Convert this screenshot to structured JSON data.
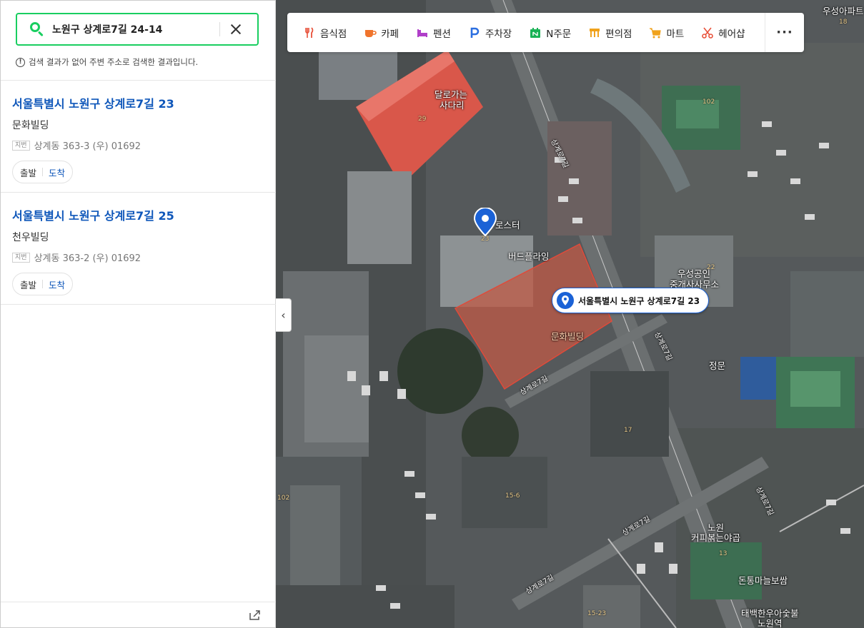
{
  "search": {
    "value": "노원구 상계로7길 24-14"
  },
  "notice": "검색 결과가 없어 주변 주소로 검색한 결과입니다.",
  "results": [
    {
      "title": "서울특별시 노원구 상계로7길 23",
      "name": "문화빌딩",
      "jibun_tag": "지번",
      "jibun": "상계동 363-3 (우) 01692",
      "start": "출발",
      "arrive": "도착"
    },
    {
      "title": "서울특별시 노원구 상계로7길 25",
      "name": "천우빌딩",
      "jibun_tag": "지번",
      "jibun": "상계동 363-2 (우) 01692",
      "start": "출발",
      "arrive": "도착"
    }
  ],
  "categories": [
    {
      "label": "음식점",
      "icon": "restaurant-icon",
      "color": "#e8513a"
    },
    {
      "label": "카페",
      "icon": "cafe-icon",
      "color": "#f0742c"
    },
    {
      "label": "펜션",
      "icon": "pension-icon",
      "color": "#b03fc9"
    },
    {
      "label": "주차장",
      "icon": "parking-icon",
      "color": "#2c6fe0"
    },
    {
      "label": "N주문",
      "icon": "order-icon",
      "color": "#19b255"
    },
    {
      "label": "편의점",
      "icon": "convenience-icon",
      "color": "#f0a21c"
    },
    {
      "label": "마트",
      "icon": "mart-icon",
      "color": "#f0a21c"
    },
    {
      "label": "헤어샵",
      "icon": "hair-icon",
      "color": "#e8513a"
    }
  ],
  "more_label": "···",
  "collapse_glyph": "‹",
  "callout": "서울특별시 노원구 상계로7길 23",
  "map_labels": {
    "woosung_apt": "우성아파트",
    "n18": "18",
    "cafe_dal": "달로가는",
    "cafe_dal2": "사다리",
    "n29": "29",
    "n102a": "102",
    "roast": "로스터",
    "n23": "23",
    "bird": "버드플라잉",
    "woosung_broker": "우성공인",
    "woosung_broker2": "중개사사무소",
    "n22": "22",
    "munhwa": "문화빌딩",
    "jeongmun": "정문",
    "n17": "17",
    "n15_6": "15-6",
    "n102b": "102",
    "nowon_cafe": "노원",
    "nowon_cafe2": "커피볶는야곱",
    "n13": "13",
    "dontong": "돈통마늘보쌈",
    "taebaek": "태백한우아숯불",
    "taebaek2": "노원역",
    "n15_23": "15-23",
    "road1": "상계로7길",
    "road2": "상계로7길",
    "road3": "상계로7길",
    "road4": "상계로7길",
    "road5": "상계로7길",
    "road6": "상계로7길"
  }
}
